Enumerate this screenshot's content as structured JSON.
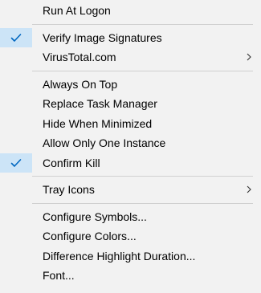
{
  "menu": {
    "items": [
      {
        "label": "Run At Logon",
        "checked": false,
        "submenu": false
      },
      {
        "separator": true
      },
      {
        "label": "Verify Image Signatures",
        "checked": true,
        "submenu": false
      },
      {
        "label": "VirusTotal.com",
        "checked": false,
        "submenu": true
      },
      {
        "separator": true
      },
      {
        "label": "Always On Top",
        "checked": false,
        "submenu": false
      },
      {
        "label": "Replace Task Manager",
        "checked": false,
        "submenu": false
      },
      {
        "label": "Hide When Minimized",
        "checked": false,
        "submenu": false
      },
      {
        "label": "Allow Only One Instance",
        "checked": false,
        "submenu": false
      },
      {
        "label": "Confirm Kill",
        "checked": true,
        "submenu": false
      },
      {
        "separator": true
      },
      {
        "label": "Tray Icons",
        "checked": false,
        "submenu": true
      },
      {
        "separator": true
      },
      {
        "label": "Configure Symbols...",
        "checked": false,
        "submenu": false
      },
      {
        "label": "Configure Colors...",
        "checked": false,
        "submenu": false
      },
      {
        "label": "Difference Highlight Duration...",
        "checked": false,
        "submenu": false
      },
      {
        "label": "Font...",
        "checked": false,
        "submenu": false
      }
    ]
  },
  "colors": {
    "menu_background": "#f2f2f2",
    "check_highlight": "#cce4f7",
    "check_mark": "#0067c0",
    "separator": "#d0d0d0"
  },
  "icons": {
    "check": "checkmark-icon",
    "submenu": "chevron-right-icon"
  }
}
